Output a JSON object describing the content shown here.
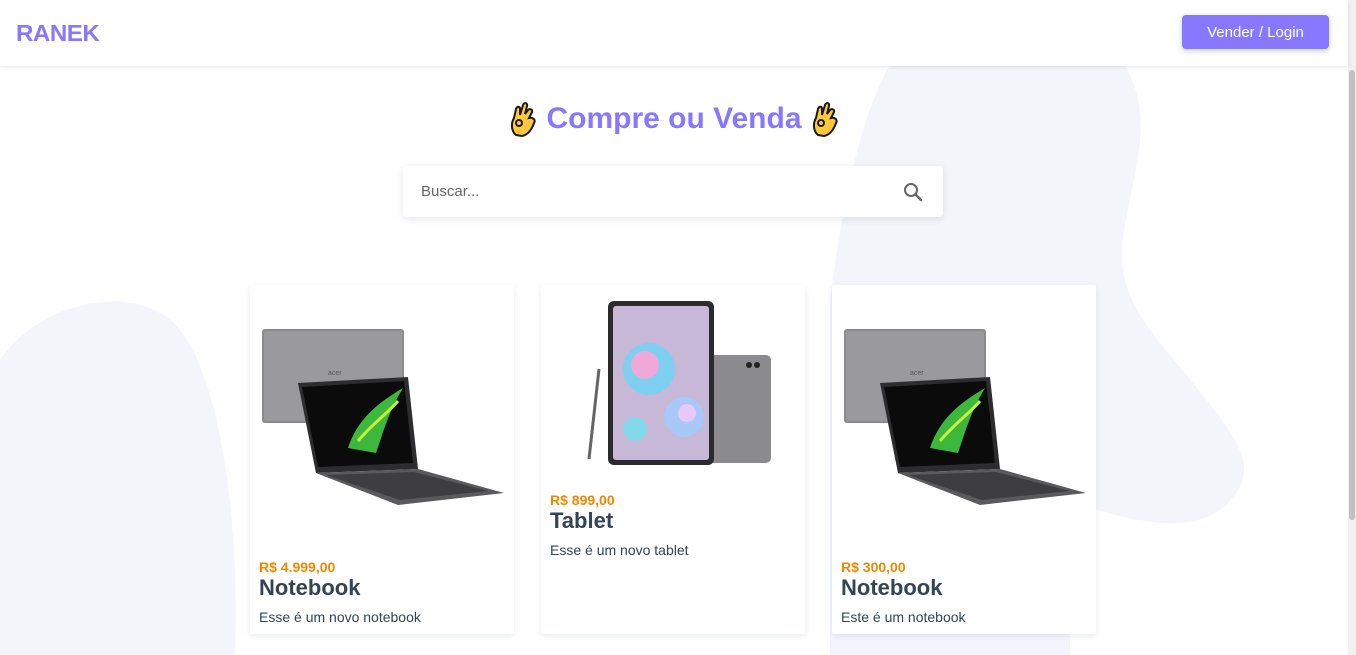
{
  "header": {
    "logo": "RANEK",
    "login_label": "Vender / Login"
  },
  "hero": {
    "title": "Compre ou Venda"
  },
  "search": {
    "placeholder": "Buscar...",
    "value": ""
  },
  "products": [
    {
      "price": "R$ 4.999,00",
      "name": "Notebook",
      "description": "Esse é um novo notebook",
      "image": "laptop-image"
    },
    {
      "price": "R$ 899,00",
      "name": "Tablet",
      "description": "Esse é um novo tablet",
      "image": "tablet-image"
    },
    {
      "price": "R$ 300,00",
      "name": "Notebook",
      "description": "Este é um notebook",
      "image": "laptop-image"
    }
  ],
  "colors": {
    "brand": "#8877ff",
    "price": "#ee8800",
    "text": "#334455",
    "background_blob": "#f2f4fb"
  },
  "icons": [
    "ok-hand-icon",
    "search-icon"
  ]
}
